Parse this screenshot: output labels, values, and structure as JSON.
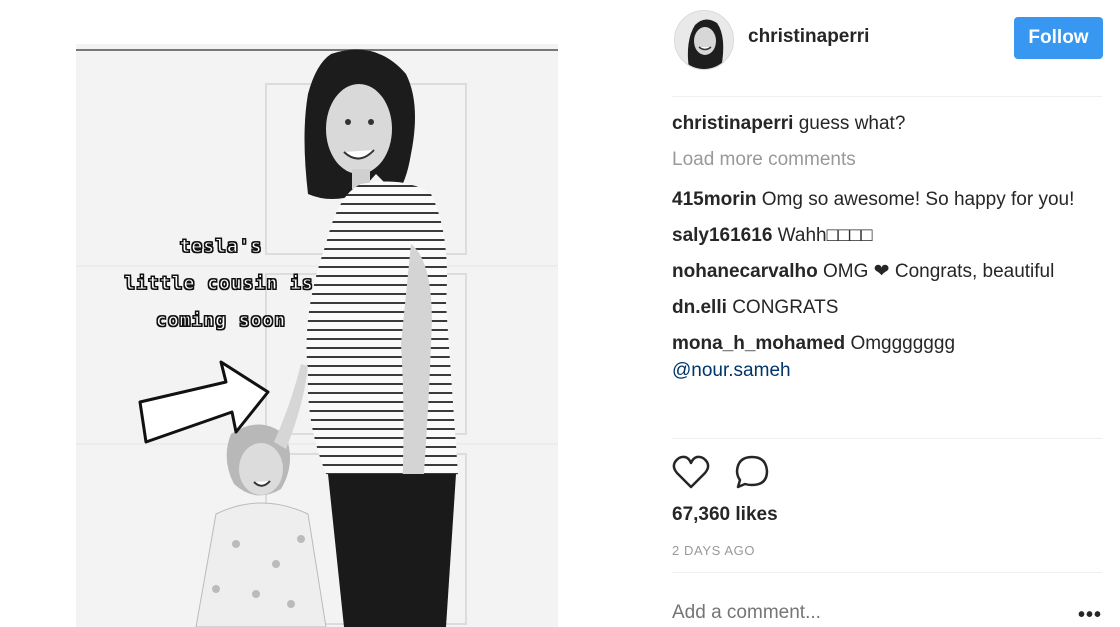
{
  "post": {
    "overlay_lines": [
      "tesla's",
      "little cousin is",
      "coming soon"
    ]
  },
  "header": {
    "username": "christinaperri",
    "follow_label": "Follow"
  },
  "caption": {
    "user": "christinaperri",
    "text": "guess what?"
  },
  "load_more_label": "Load more comments",
  "comments": [
    {
      "user": "415morin",
      "text": "Omg so awesome! So happy for you!"
    },
    {
      "user": "saly161616",
      "text": "Wahh□□□□"
    },
    {
      "user": "nohanecarvalho",
      "text": "OMG ❤ Congrats, beautiful"
    },
    {
      "user": "dn.elli",
      "text": "CONGRATS"
    },
    {
      "user": "mona_h_mohamed",
      "text": "Omggggggg",
      "mention": "@nour.sameh"
    }
  ],
  "actions": {
    "like_icon": "heart-outline-icon",
    "comment_icon": "comment-bubble-icon"
  },
  "likes_label": "67,360 likes",
  "timestamp": "2 DAYS AGO",
  "add_comment": {
    "placeholder": "Add a comment..."
  },
  "more_label": "•••",
  "colors": {
    "follow_bg": "#3897f0",
    "muted": "#999999",
    "mention": "#003569"
  }
}
